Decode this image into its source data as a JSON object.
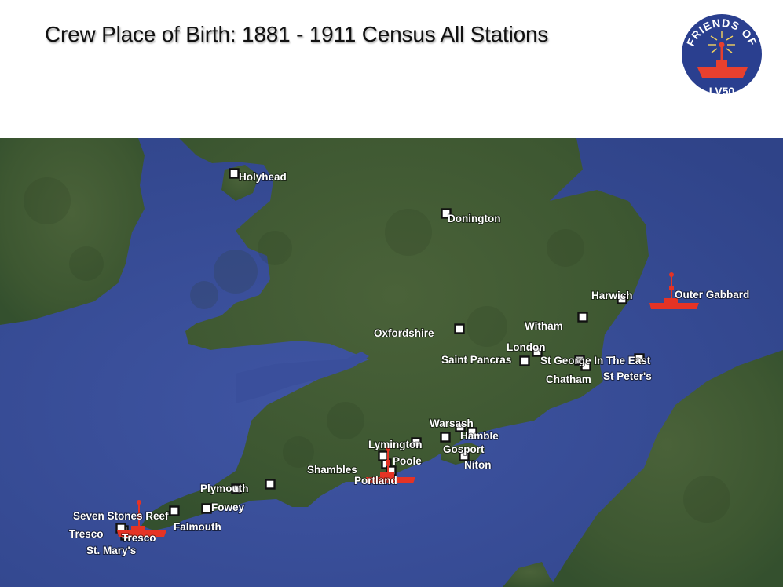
{
  "title": "Crew Place of Birth: 1881 - 1911 Census All Stations",
  "logo": {
    "top_text": "FRIENDS OF",
    "bottom_text": "LV50",
    "colors": {
      "ring": "#2a3f8f",
      "ship": "#e8402e",
      "text": "#ffffff"
    }
  },
  "colors": {
    "sea": "#3a4e9a",
    "land": "#3f5a34",
    "marker_fill": "#ffffff",
    "ship": "#e53325"
  },
  "places": [
    {
      "name": "Holyhead",
      "label": "Holyhead"
    },
    {
      "name": "Donington",
      "label": "Donington"
    },
    {
      "name": "Harwich",
      "label": "Harwich"
    },
    {
      "name": "Witham",
      "label": "Witham"
    },
    {
      "name": "Oxfordshire",
      "label": "Oxfordshire"
    },
    {
      "name": "London",
      "label": "London"
    },
    {
      "name": "Saint Pancras",
      "label": "Saint Pancras"
    },
    {
      "name": "St George In The East",
      "label": "St George In The East"
    },
    {
      "name": "Chatham",
      "label": "Chatham"
    },
    {
      "name": "St Peter's",
      "label": "St Peter's"
    },
    {
      "name": "Warsash",
      "label": "Warsash"
    },
    {
      "name": "Hamble",
      "label": "Hamble"
    },
    {
      "name": "Lymington",
      "label": "Lymington"
    },
    {
      "name": "Gosport",
      "label": "Gosport"
    },
    {
      "name": "Poole",
      "label": "Poole"
    },
    {
      "name": "Niton",
      "label": "Niton"
    },
    {
      "name": "Shambles",
      "label": "Shambles"
    },
    {
      "name": "Portland",
      "label": "Portland"
    },
    {
      "name": "Plymouth",
      "label": "Plymouth"
    },
    {
      "name": "Fowey",
      "label": "Fowey"
    },
    {
      "name": "Seven Stones Reef",
      "label": "Seven Stones Reef"
    },
    {
      "name": "Falmouth",
      "label": "Falmouth"
    },
    {
      "name": "Tresco",
      "label": "Tresco"
    },
    {
      "name": "Tresco (overlapping)",
      "label": "Tresco"
    },
    {
      "name": "St. Mary's",
      "label": "St. Mary's"
    },
    {
      "name": "Outer Gabbard",
      "label": "Outer Gabbard"
    }
  ],
  "lightships": [
    "Outer Gabbard",
    "Shambles",
    "Seven Stones Reef"
  ]
}
